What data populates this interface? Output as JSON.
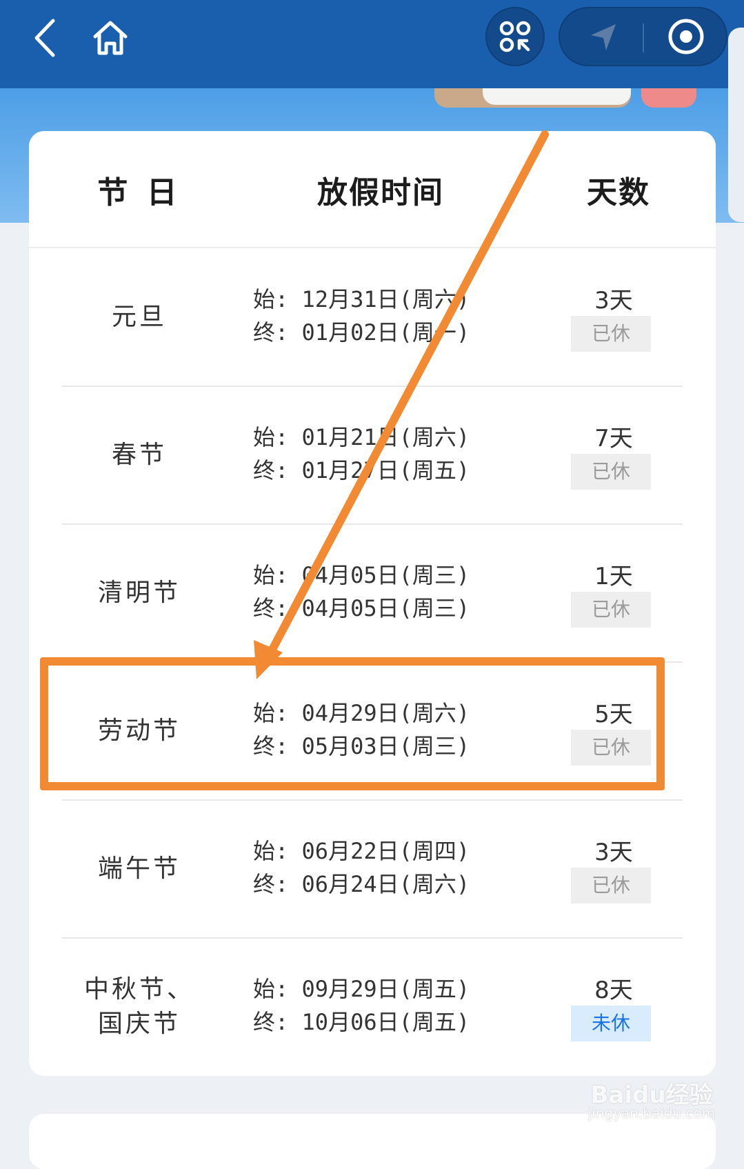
{
  "header": {
    "back_icon": "chevron-left-icon",
    "home_icon": "home-icon",
    "scan_icon": "mini-program-icon",
    "location_icon": "navigation-icon",
    "close_icon": "record-circle-icon"
  },
  "table": {
    "headers": {
      "festival": "节 日",
      "period": "放假时间",
      "days": "天数"
    },
    "rows": [
      {
        "name_line1": "元旦",
        "name_line2": "",
        "start": "始: 12月31日(周六)",
        "end": "终: 01月02日(周一)",
        "days": "3天",
        "status": "已休"
      },
      {
        "name_line1": "春节",
        "name_line2": "",
        "start": "始: 01月21日(周六)",
        "end": "终: 01月27日(周五)",
        "days": "7天",
        "status": "已休"
      },
      {
        "name_line1": "清明节",
        "name_line2": "",
        "start": "始: 04月05日(周三)",
        "end": "终: 04月05日(周三)",
        "days": "1天",
        "status": "已休"
      },
      {
        "name_line1": "劳动节",
        "name_line2": "",
        "start": "始: 04月29日(周六)",
        "end": "终: 05月03日(周三)",
        "days": "5天",
        "status": "已休"
      },
      {
        "name_line1": "端午节",
        "name_line2": "",
        "start": "始: 06月22日(周四)",
        "end": "终: 06月24日(周六)",
        "days": "3天",
        "status": "已休"
      },
      {
        "name_line1": "中秋节、",
        "name_line2": "国庆节",
        "start": "始: 09月29日(周五)",
        "end": "终: 10月06日(周五)",
        "days": "8天",
        "status": "未休"
      }
    ]
  },
  "watermark": {
    "logo": "Baidu经验",
    "url": "jingyan.baidu.com"
  },
  "colors": {
    "header": "#1a5fae",
    "accent_orange": "#f28a33",
    "badge_blue": "#1a73e8"
  }
}
